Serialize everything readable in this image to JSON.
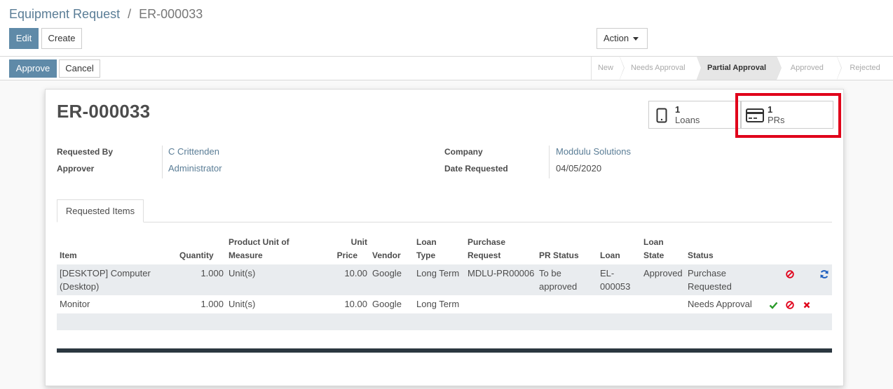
{
  "breadcrumb": {
    "parent": "Equipment Request",
    "separator": "/",
    "current": "ER-000033"
  },
  "toolbar": {
    "edit_label": "Edit",
    "create_label": "Create",
    "action_label": "Action"
  },
  "statusbar": {
    "approve_label": "Approve",
    "cancel_label": "Cancel",
    "stages": [
      {
        "label": "New",
        "active": false
      },
      {
        "label": "Needs Approval",
        "active": false
      },
      {
        "label": "Partial Approval",
        "active": true
      },
      {
        "label": "Approved",
        "active": false
      },
      {
        "label": "Rejected",
        "active": false
      }
    ]
  },
  "record": {
    "title": "ER-000033",
    "smart_buttons": [
      {
        "count": "1",
        "label": "Loans",
        "icon": "tablet-icon"
      },
      {
        "count": "1",
        "label": "PRs",
        "icon": "credit-card-icon"
      }
    ],
    "fields": {
      "requested_by_label": "Requested By",
      "requested_by": "C Crittenden",
      "approver_label": "Approver",
      "approver": "Administrator",
      "company_label": "Company",
      "company": "Moddulu Solutions",
      "date_requested_label": "Date Requested",
      "date_requested": "04/05/2020"
    }
  },
  "tabs": {
    "requested_items": "Requested Items"
  },
  "table": {
    "headers": {
      "item": "Item",
      "quantity": "Quantity",
      "uom_line1": "Product Unit of",
      "uom_line2": "Measure",
      "unit_price_line1": "Unit",
      "unit_price_line2": "Price",
      "vendor": "Vendor",
      "loan_type_line1": "Loan",
      "loan_type_line2": "Type",
      "purchase_request_line1": "Purchase",
      "purchase_request_line2": "Request",
      "pr_status": "PR Status",
      "loan": "Loan",
      "loan_state_line1": "Loan",
      "loan_state_line2": "State",
      "status": "Status"
    },
    "rows": [
      {
        "item_line1": "[DESKTOP] Computer",
        "item_line2": "(Desktop)",
        "quantity": "1.000",
        "uom": "Unit(s)",
        "unit_price": "10.00",
        "vendor": "Google",
        "loan_type": "Long Term",
        "purchase_request": "MDLU-PR00006",
        "pr_status_line1": "To be",
        "pr_status_line2": "approved",
        "loan_line1": "EL-",
        "loan_line2": "000053",
        "loan_state": "Approved",
        "status_line1": "Purchase",
        "status_line2": "Requested",
        "actions": [
          "reject-icon",
          "refresh-icon"
        ]
      },
      {
        "item_line1": "Monitor",
        "quantity": "1.000",
        "uom": "Unit(s)",
        "unit_price": "10.00",
        "vendor": "Google",
        "loan_type": "Long Term",
        "status_line1": "Needs Approval",
        "actions": [
          "approve-check-icon",
          "reject-icon",
          "delete-x-icon"
        ]
      }
    ]
  },
  "colors": {
    "primary": "#5f8aa8",
    "link": "#5a7d96",
    "highlight": "#e0001a",
    "check": "#2a9a2a",
    "danger": "#e0001a",
    "refresh": "#1f5fbf"
  }
}
